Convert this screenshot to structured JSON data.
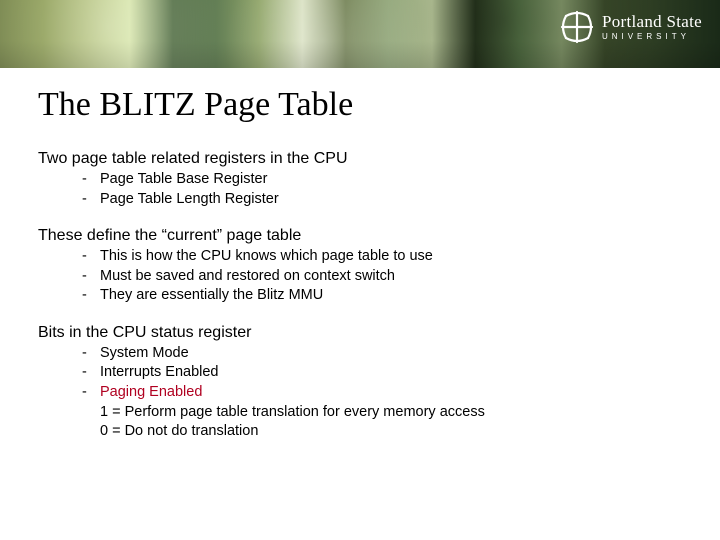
{
  "logo": {
    "line1": "Portland State",
    "line2": "UNIVERSITY"
  },
  "title": "The BLITZ Page Table",
  "sections": [
    {
      "heading": "Two page table related registers in the CPU",
      "items": [
        {
          "text": "Page Table Base Register"
        },
        {
          "text": "Page Table Length Register"
        }
      ]
    },
    {
      "heading": "These define the “current” page table",
      "items": [
        {
          "text": "This is how the CPU knows which page table to use"
        },
        {
          "text": "Must be saved and restored on context switch"
        },
        {
          "text": "They are essentially the Blitz MMU"
        }
      ]
    },
    {
      "heading": "Bits in the CPU status register",
      "items": [
        {
          "text": "System Mode"
        },
        {
          "text": "Interrupts Enabled"
        },
        {
          "text": "Paging Enabled",
          "red": true,
          "sub": [
            "1 = Perform page table translation for every memory access",
            "0 = Do not do translation"
          ]
        }
      ]
    }
  ]
}
